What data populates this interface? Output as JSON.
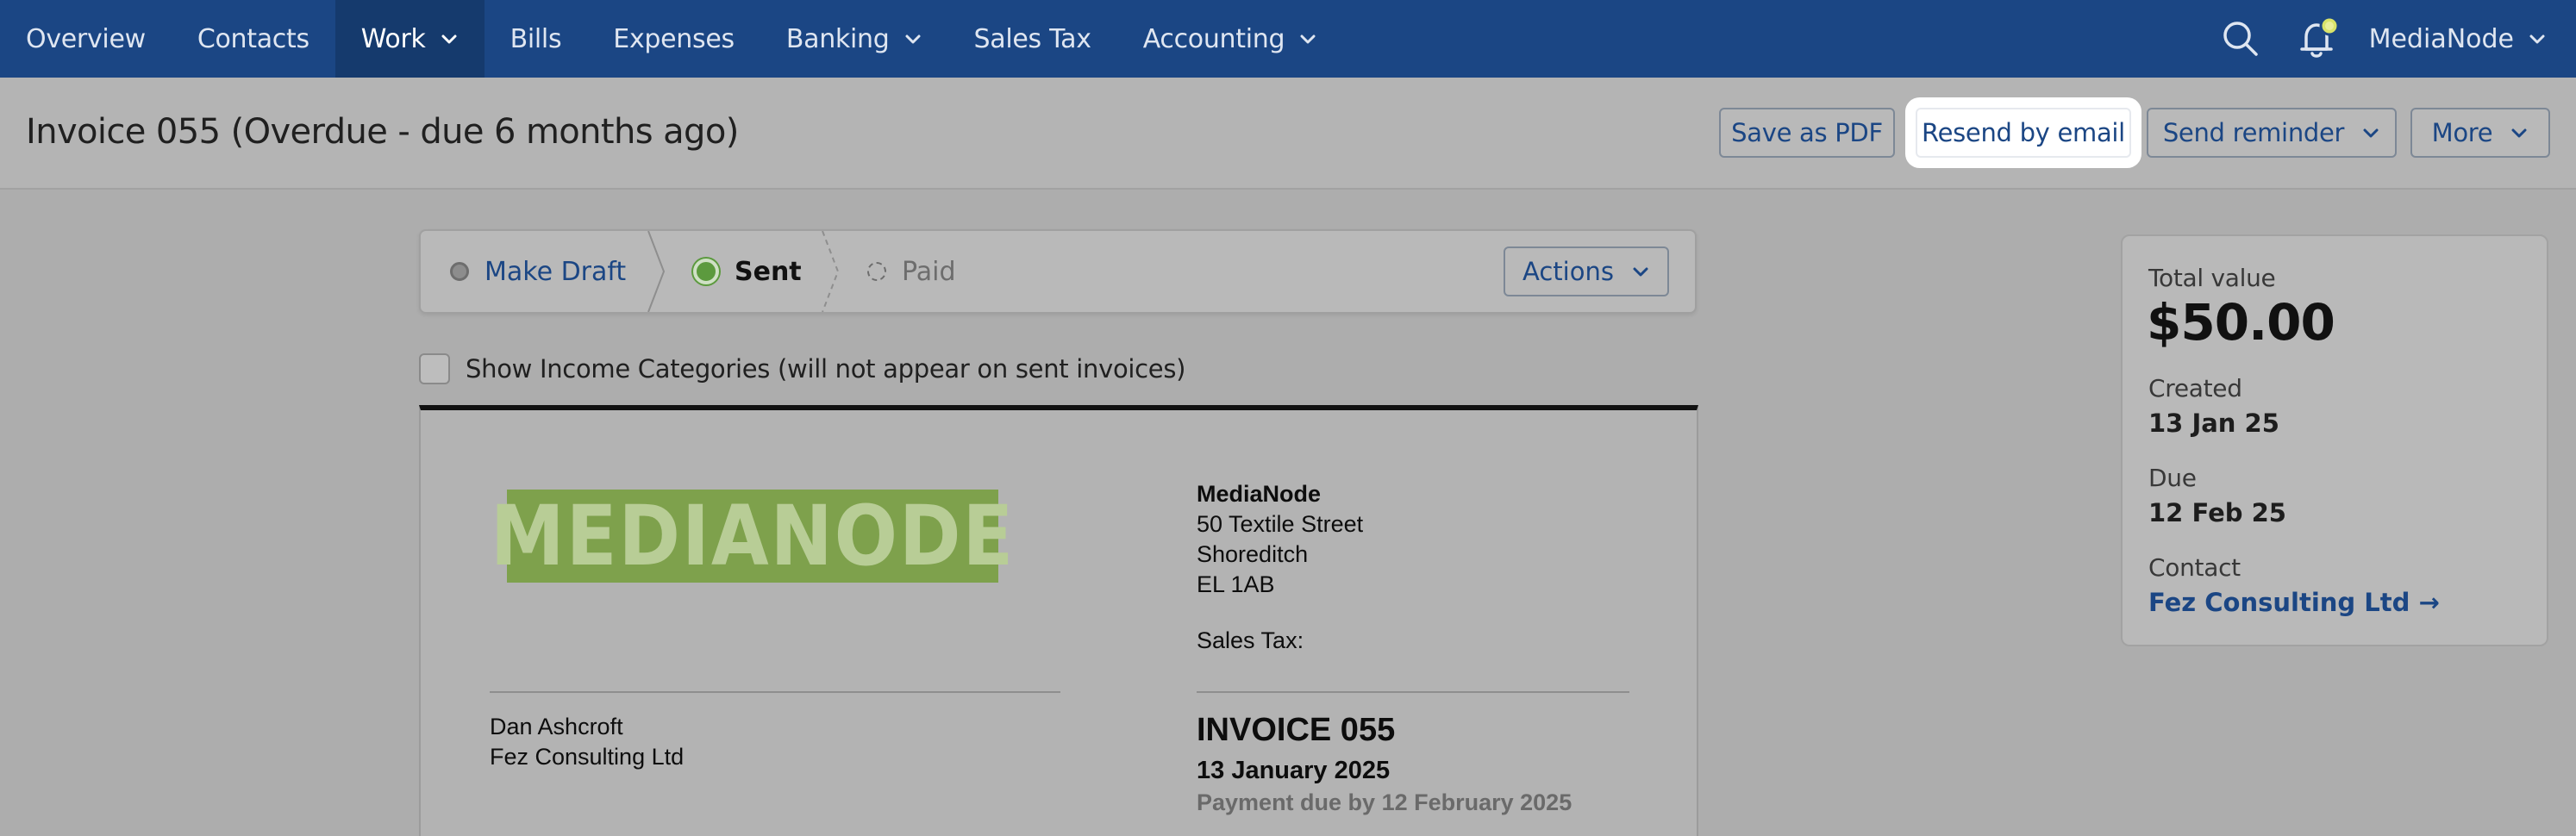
{
  "nav": {
    "items": [
      {
        "label": "Overview",
        "dropdown": false
      },
      {
        "label": "Contacts",
        "dropdown": false
      },
      {
        "label": "Work",
        "dropdown": true,
        "active": true
      },
      {
        "label": "Bills",
        "dropdown": false
      },
      {
        "label": "Expenses",
        "dropdown": false
      },
      {
        "label": "Banking",
        "dropdown": true
      },
      {
        "label": "Sales Tax",
        "dropdown": false
      },
      {
        "label": "Accounting",
        "dropdown": true
      }
    ],
    "icons": {
      "search": "search-icon",
      "notifications": "bell-icon"
    },
    "user": "MediaNode"
  },
  "header": {
    "title": "Invoice 055 (Overdue - due 6 months ago)",
    "buttons": {
      "save_pdf": "Save as PDF",
      "resend": "Resend by email",
      "reminder": "Send reminder",
      "more": "More"
    }
  },
  "status": {
    "steps": {
      "draft": "Make Draft",
      "sent": "Sent",
      "paid": "Paid"
    },
    "actions": "Actions"
  },
  "options": {
    "show_categories": "Show Income Categories (will not appear on sent invoices)"
  },
  "invoice": {
    "logo_text": "MEDIANODE",
    "company": {
      "name": "MediaNode",
      "address_1": "50 Textile Street",
      "address_2": "Shoreditch",
      "postcode": "EL 1AB",
      "sales_tax": "Sales Tax:"
    },
    "client": {
      "person": "Dan Ashcroft",
      "company": "Fez Consulting Ltd"
    },
    "number": "INVOICE 055",
    "date": "13 January 2025",
    "due": "Payment due by 12 February 2025"
  },
  "summary": {
    "total_label": "Total value",
    "total_value": "$50.00",
    "created_label": "Created",
    "created_value": "13 Jan 25",
    "due_label": "Due",
    "due_value": "12 Feb 25",
    "contact_label": "Contact",
    "contact_value": "Fez Consulting Ltd →"
  },
  "colors": {
    "nav_bg": "#1b4684",
    "link": "#1b4684",
    "sent_green": "#5c9a3e",
    "logo_green": "#7ea14c",
    "notification_badge": "#d9e36a"
  }
}
